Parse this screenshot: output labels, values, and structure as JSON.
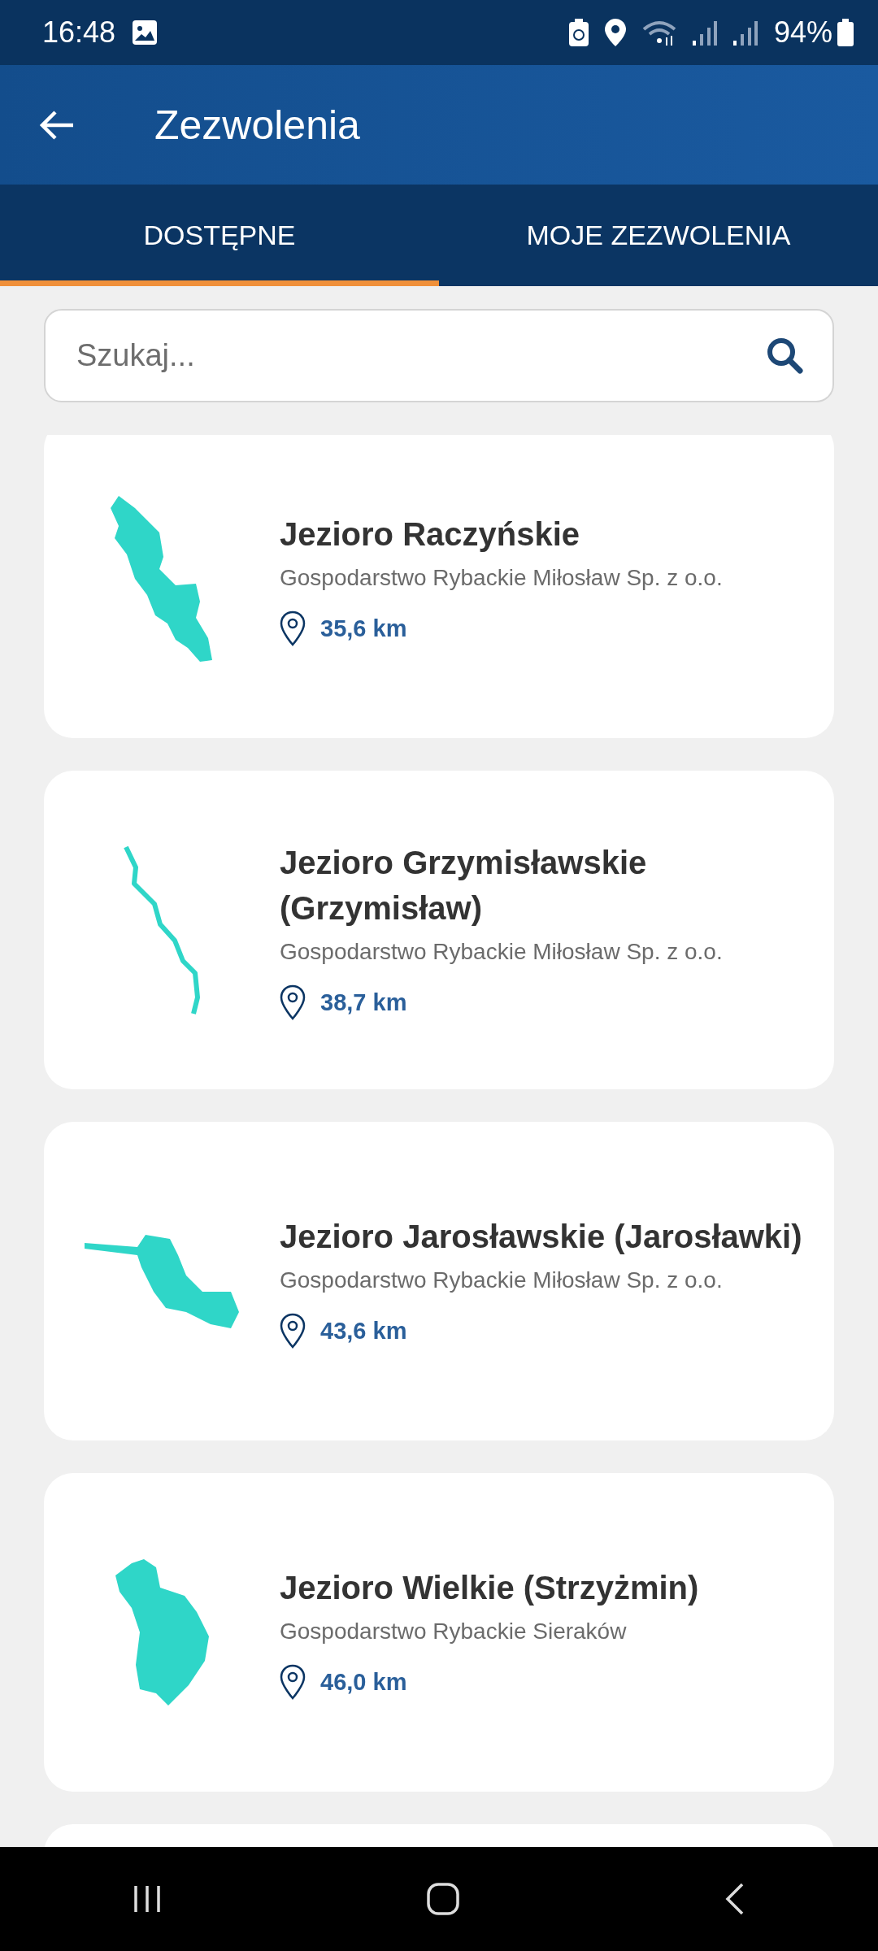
{
  "status_bar": {
    "time": "16:48",
    "battery": "94%"
  },
  "app_bar": {
    "title": "Zezwolenia"
  },
  "tabs": [
    {
      "label": "DOSTĘPNE",
      "selected": true
    },
    {
      "label": "MOJE ZEZWOLENIA",
      "selected": false
    }
  ],
  "search": {
    "placeholder": "Szukaj..."
  },
  "lakes": [
    {
      "name": "Jezioro Raczyńskie",
      "owner": "Gospodarstwo Rybackie Miłosław Sp. z o.o.",
      "distance": "35,6 km"
    },
    {
      "name": "Jezioro Grzymisławskie (Grzymisław)",
      "owner": "Gospodarstwo Rybackie Miłosław Sp. z o.o.",
      "distance": "38,7 km"
    },
    {
      "name": "Jezioro Jarosławskie (Jarosławki)",
      "owner": "Gospodarstwo Rybackie Miłosław Sp. z o.o.",
      "distance": "43,6 km"
    },
    {
      "name": "Jezioro Wielkie (Strzyżmin)",
      "owner": "Gospodarstwo Rybackie Sieraków",
      "distance": "46,0 km"
    }
  ]
}
